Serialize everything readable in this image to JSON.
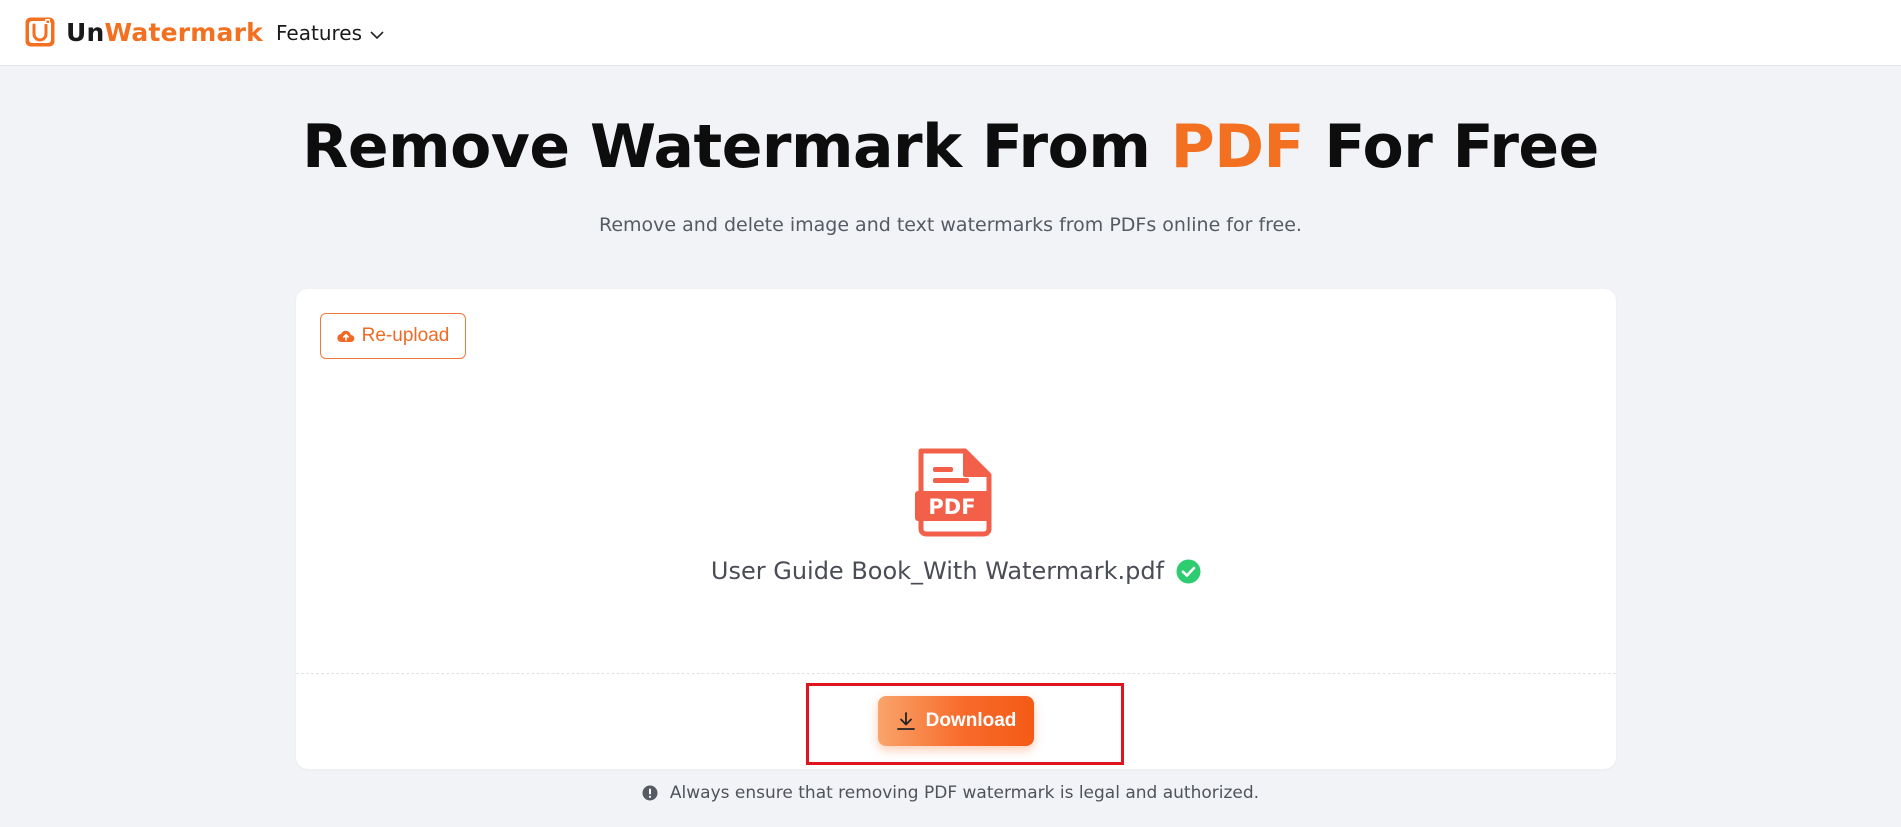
{
  "header": {
    "logo_prefix": "Un",
    "logo_suffix": "Watermark",
    "nav": {
      "features_label": "Features"
    }
  },
  "hero": {
    "title_before": "Remove Watermark From ",
    "title_accent": "PDF",
    "title_after": " For Free",
    "subtitle": "Remove and delete image and text watermarks from PDFs online for free."
  },
  "upload_card": {
    "reupload_label": "Re-upload",
    "file_icon_label": "PDF",
    "file_name": "User Guide Book_With Watermark.pdf",
    "download_label": "Download"
  },
  "notice": {
    "text": "Always ensure that removing PDF watermark is legal and authorized."
  },
  "icons": {
    "logo": "unwatermark-logo-icon",
    "features_chevron": "chevron-down-icon",
    "reupload": "cloud-upload-icon",
    "file": "pdf-file-icon",
    "status": "check-circle-icon",
    "download": "download-icon",
    "notice": "info-icon"
  },
  "colors": {
    "brand_orange": "#f37021",
    "success_green": "#2ecc71",
    "pdf_red": "#f2604a",
    "highlight_red": "#e0141c"
  }
}
